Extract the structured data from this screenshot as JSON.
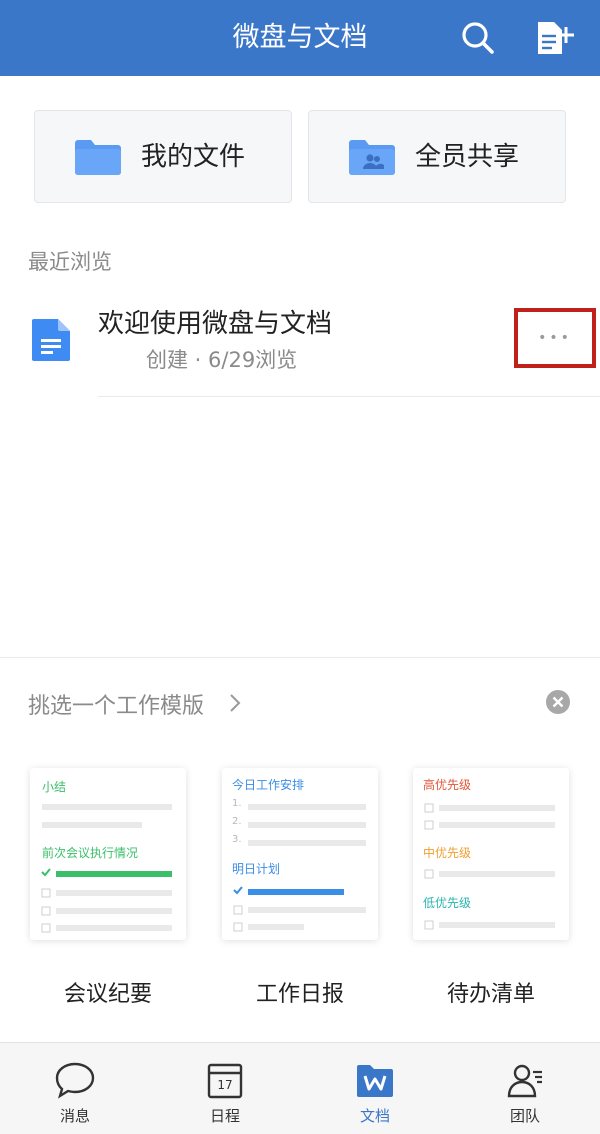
{
  "header": {
    "title": "微盘与文档"
  },
  "entries": [
    {
      "label": "我的文件",
      "icon": "folder-icon"
    },
    {
      "label": "全员共享",
      "icon": "shared-folder-icon"
    }
  ],
  "recent": {
    "section_label": "最近浏览",
    "items": [
      {
        "title": "欢迎使用微盘与文档",
        "subtitle": "创建 · 6/29浏览",
        "icon": "document-icon"
      }
    ]
  },
  "templates": {
    "heading": "挑选一个工作模版",
    "cards": [
      {
        "name": "会议纪要",
        "lines": [
          "小结",
          "前次会议执行情况"
        ]
      },
      {
        "name": "工作日报",
        "lines": [
          "今日工作安排",
          "明日计划"
        ],
        "numbers": [
          "1.",
          "2.",
          "3."
        ]
      },
      {
        "name": "待办清单",
        "lines": [
          "高优先级",
          "中优先级",
          "低优先级"
        ]
      }
    ]
  },
  "tabs": [
    {
      "label": "消息",
      "icon": "chat-bubble-icon"
    },
    {
      "label": "日程",
      "icon": "calendar-icon",
      "calendar_day": "17"
    },
    {
      "label": "文档",
      "icon": "docs-w-icon",
      "active": true
    },
    {
      "label": "团队",
      "icon": "team-icon"
    }
  ],
  "colors": {
    "primary": "#3b77c9",
    "green": "#3bbf6a",
    "blue": "#3a8ee6",
    "red": "#e2563a",
    "orange": "#f0a030",
    "teal": "#2bb5b0",
    "highlight_border": "#c0221a"
  }
}
